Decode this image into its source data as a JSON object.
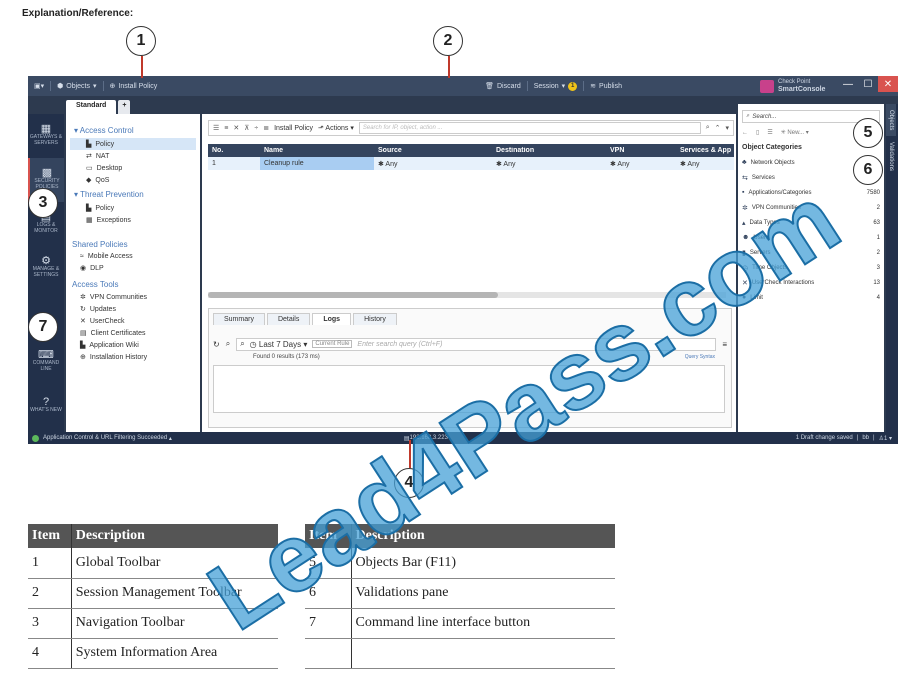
{
  "heading": "Explanation/Reference:",
  "callouts": [
    "1",
    "2",
    "3",
    "4",
    "5",
    "6",
    "7"
  ],
  "global_toolbar": {
    "menu_label": "",
    "objects_label": "Objects",
    "install_policy_label": "Install Policy"
  },
  "session_toolbar": {
    "discard_label": "Discard",
    "session_label": "Session",
    "session_badge": "1",
    "publish_label": "Publish"
  },
  "brand": {
    "line1": "Check Point",
    "line2": "SmartConsole"
  },
  "window": {
    "minimize": "—",
    "maximize": "☐",
    "close": "✕"
  },
  "tabs": {
    "standard": "Standard",
    "add": "+"
  },
  "nav": [
    {
      "label": "GATEWAYS & SERVERS",
      "icon": "▦"
    },
    {
      "label": "SECURITY POLICIES",
      "icon": "▩"
    },
    {
      "label": "LOGS & MONITOR",
      "icon": "▤"
    },
    {
      "label": "MANAGE & SETTINGS",
      "icon": "⚙"
    },
    {
      "label": "COMMAND LINE",
      "icon": "⌨"
    },
    {
      "label": "WHAT'S NEW",
      "icon": "?"
    }
  ],
  "tree": {
    "access_control": "Access Control",
    "ac_items": [
      "Policy",
      "NAT",
      "Desktop",
      "QoS"
    ],
    "threat_prevention": "Threat Prevention",
    "tp_items": [
      "Policy",
      "Exceptions"
    ],
    "shared_policies": "Shared Policies",
    "shared_items": [
      "Mobile Access",
      "DLP"
    ],
    "access_tools": "Access Tools",
    "tools_items": [
      "VPN Communities",
      "Updates",
      "UserCheck",
      "Client Certificates",
      "Application Wiki",
      "Installation History"
    ]
  },
  "policy_toolbar": {
    "install_policy": "Install Policy",
    "actions": "Actions",
    "search_placeholder": "Search for IP, object, action ..."
  },
  "rules_table": {
    "columns": [
      "No.",
      "Name",
      "Source",
      "Destination",
      "VPN",
      "Services & App"
    ],
    "rows": [
      [
        "1",
        "Cleanup rule",
        "✱ Any",
        "✱ Any",
        "✱ Any",
        "✱ Any"
      ]
    ]
  },
  "bottom_pane": {
    "tabs": [
      "Summary",
      "Details",
      "Logs",
      "History"
    ],
    "active_tab": "Logs",
    "time_range": "Last 7 Days",
    "current_rule": "Current Rule",
    "query_placeholder": "Enter search query (Ctrl+F)",
    "found": "Found 0 results (173 ms)",
    "query_syntax": "Query Syntax"
  },
  "objects_bar": {
    "search_placeholder": "Search...",
    "new_label": "New...",
    "categories_title": "Object Categories",
    "categories": [
      {
        "name": "Network Objects",
        "count": "",
        "icon": "♣"
      },
      {
        "name": "Services",
        "count": "511",
        "icon": "⇆"
      },
      {
        "name": "Applications/Categories",
        "count": "7580",
        "icon": "▪"
      },
      {
        "name": "VPN Communities",
        "count": "2",
        "icon": "✲"
      },
      {
        "name": "Data Types",
        "count": "63",
        "icon": "▴"
      },
      {
        "name": "Users",
        "count": "1",
        "icon": "☻"
      },
      {
        "name": "Servers",
        "count": "2",
        "icon": "▮"
      },
      {
        "name": "Time Objects",
        "count": "3",
        "icon": "◷"
      },
      {
        "name": "UserCheck Interactions",
        "count": "13",
        "icon": "✕"
      },
      {
        "name": "Limit",
        "count": "4",
        "icon": "●"
      }
    ]
  },
  "side_tabs": {
    "objects": "Objects",
    "validations": "Validations"
  },
  "status_bar": {
    "message": "Application Control & URL Filtering Succeeded",
    "server": "192.168.3.223",
    "draft": "1 Draft change saved",
    "user": "bb",
    "sessions": "1"
  },
  "legend_left": {
    "headers": [
      "Item",
      "Description"
    ],
    "rows": [
      [
        "1",
        "Global Toolbar"
      ],
      [
        "2",
        "Session Management Toolbar"
      ],
      [
        "3",
        "Navigation Toolbar"
      ],
      [
        "4",
        "System Information Area"
      ]
    ]
  },
  "legend_right": {
    "headers": [
      "Item",
      "Description"
    ],
    "rows": [
      [
        "5",
        "Objects Bar (F11)"
      ],
      [
        "6",
        "Validations pane"
      ],
      [
        "7",
        "Command line interface button"
      ],
      [
        "",
        ""
      ]
    ]
  },
  "watermark": "Lead4Pass.com"
}
